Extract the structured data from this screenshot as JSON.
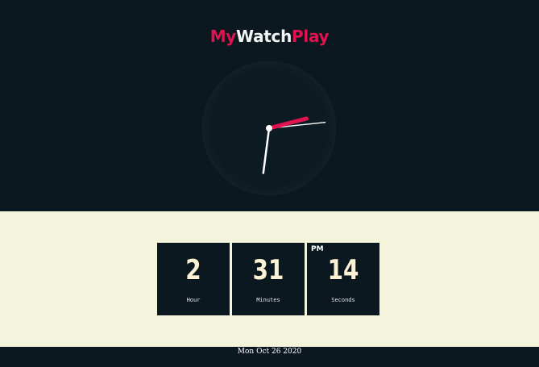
{
  "app": {
    "title_part1": "My",
    "title_part2": "Watch",
    "title_part3": "Play"
  },
  "clock": {
    "hour": 2,
    "minute": 31,
    "second": 14,
    "accent_color": "#e0124f",
    "hand_color": "#ffffff"
  },
  "digital": {
    "hour_value": "2",
    "hour_label": "Hour",
    "minute_value": "31",
    "minute_label": "Minutes",
    "second_value": "14",
    "second_label": "Seconds",
    "ampm": "PM"
  },
  "footer": {
    "date": "Mon Oct 26 2020"
  },
  "colors": {
    "dark_bg": "#0b1820",
    "light_bg": "#f4f3dc",
    "accent": "#e0124f",
    "digit": "#fbf1d4"
  }
}
